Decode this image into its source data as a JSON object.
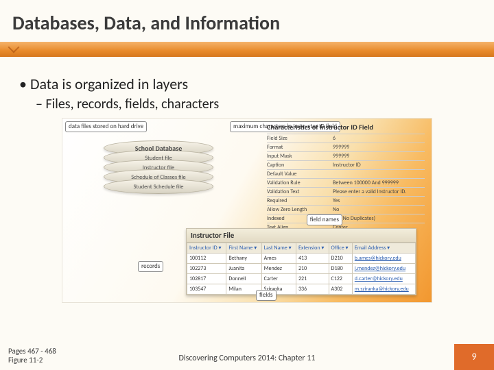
{
  "title": "Databases, Data, and Information",
  "bullets": {
    "main": "Data is organized in layers",
    "sub": "Files, records, fields, characters"
  },
  "figure": {
    "label_datafiles": "data files\nstored on hard drive",
    "label_maxchars": "maximum\ncharacters in\nInstructor ID\nfield",
    "label_fieldnames": "field names",
    "label_records": "records",
    "label_fields": "fields",
    "disc_top": "School Database",
    "disc1": "Student file",
    "disc2": "Instructor file",
    "disc3": "Schedule of Classes file",
    "disc4": "Student Schedule file",
    "char_title": "Characteristics of Instructor ID Field",
    "characteristics": [
      {
        "k": "Field Size",
        "v": "6"
      },
      {
        "k": "Format",
        "v": "999999"
      },
      {
        "k": "Input Mask",
        "v": "999999"
      },
      {
        "k": "Caption",
        "v": "Instructor ID"
      },
      {
        "k": "Default Value",
        "v": ""
      },
      {
        "k": "Validation Rule",
        "v": "Between 100000 And 999999"
      },
      {
        "k": "Validation Text",
        "v": "Please enter a valid Instructor ID."
      },
      {
        "k": "Required",
        "v": "Yes"
      },
      {
        "k": "Allow Zero Length",
        "v": "No"
      },
      {
        "k": "Indexed",
        "v": "Yes (No Duplicates)"
      },
      {
        "k": "Text Align",
        "v": "Center"
      }
    ],
    "if_title": "Instructor File",
    "if_headers": [
      "Instructor ID",
      "First Name",
      "Last Name",
      "Extension",
      "Office",
      "Email Address"
    ],
    "if_rows": [
      [
        "100112",
        "Bethany",
        "Ames",
        "413",
        "D210",
        "b.ames@hickory.edu"
      ],
      [
        "102273",
        "Juanita",
        "Mendez",
        "210",
        "D180",
        "j.mendez@hickory.edu"
      ],
      [
        "102817",
        "Donnell",
        "Carter",
        "221",
        "C122",
        "d.carter@hickory.edu"
      ],
      [
        "103547",
        "Milan",
        "Sziranka",
        "336",
        "A302",
        "m.sziranka@hickory.edu"
      ]
    ]
  },
  "footer": {
    "page_ref_line1": "Pages 467 - 468",
    "page_ref_line2": "Figure 11-2",
    "center": "Discovering Computers 2014: Chapter 11",
    "slide_number": "9"
  }
}
